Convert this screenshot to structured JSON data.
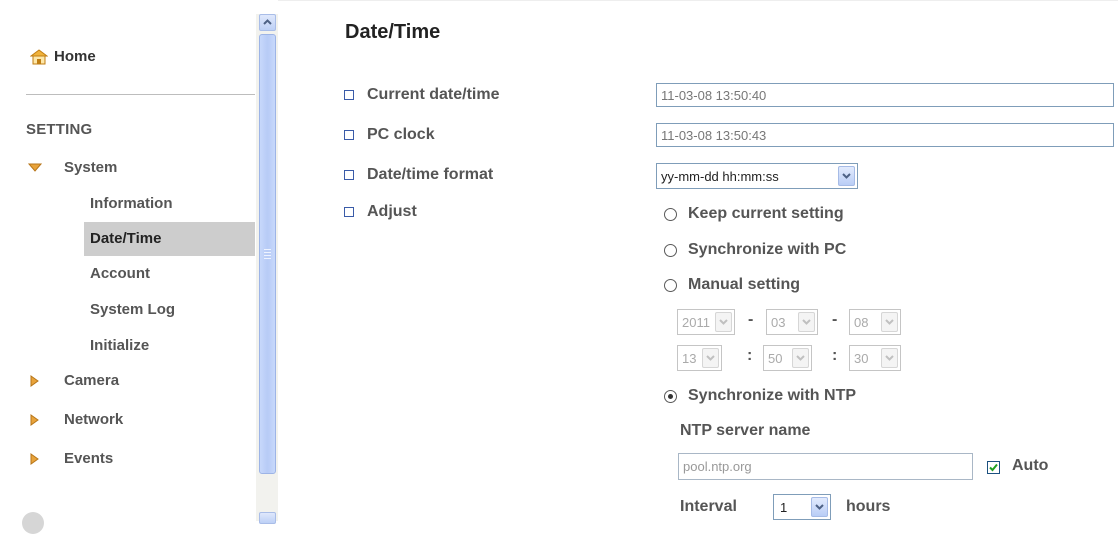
{
  "sidebar": {
    "home_label": "Home",
    "section_title": "SETTING",
    "system_label": "System",
    "system_items": [
      {
        "label": "Information",
        "active": false
      },
      {
        "label": "Date/Time",
        "active": true
      },
      {
        "label": "Account",
        "active": false
      },
      {
        "label": "System Log",
        "active": false
      },
      {
        "label": "Initialize",
        "active": false
      }
    ],
    "camera_label": "Camera",
    "network_label": "Network",
    "events_label": "Events"
  },
  "main": {
    "title": "Date/Time",
    "current_label": "Current date/time",
    "current_value": "11-03-08   13:50:40",
    "pc_clock_label": "PC clock",
    "pc_clock_value": "11-03-08   13:50:43",
    "format_label": "Date/time format",
    "format_value": "yy-mm-dd hh:mm:ss",
    "adjust_label": "Adjust",
    "radio_keep": "Keep current setting",
    "radio_sync_pc": "Synchronize with PC",
    "radio_manual": "Manual setting",
    "manual": {
      "year": "2011",
      "month": "03",
      "day": "08",
      "hour": "13",
      "minute": "50",
      "second": "30",
      "date_sep": "-",
      "time_sep": ":"
    },
    "radio_ntp": "Synchronize with NTP",
    "selected_option": "Synchronize with NTP",
    "ntp_server_label": "NTP server name",
    "ntp_server_value": "pool.ntp.org",
    "auto_label": "Auto",
    "auto_checked": true,
    "interval_label": "Interval",
    "interval_value": "1",
    "interval_unit": "hours"
  },
  "colors": {
    "active_nav_bg": "#cdcdcd",
    "bullet_border": "#3a5ba8",
    "nav_triangle": "#e8a33a",
    "scrollbar": "#b7cbf6"
  }
}
